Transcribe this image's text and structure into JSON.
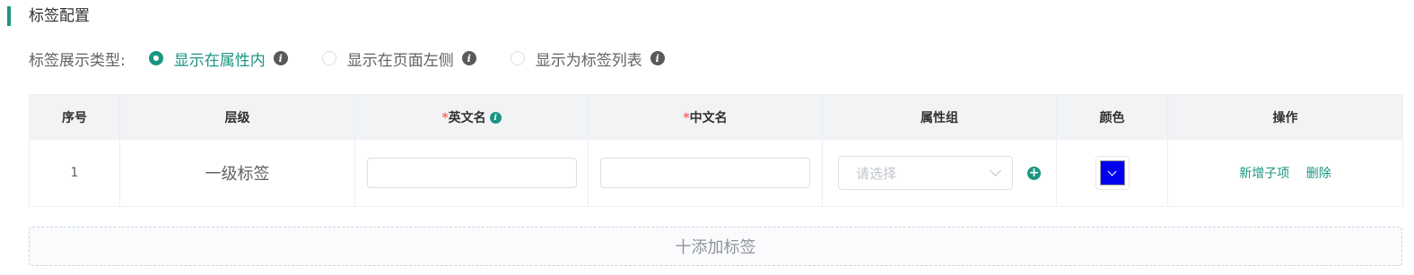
{
  "section": {
    "title": "标签配置"
  },
  "display_type": {
    "label": "标签展示类型:",
    "options": [
      {
        "label": "显示在属性内",
        "checked": true
      },
      {
        "label": "显示在页面左侧",
        "checked": false
      },
      {
        "label": "显示为标签列表",
        "checked": false
      }
    ]
  },
  "table": {
    "headers": {
      "index": "序号",
      "level": "层级",
      "en_required": "*",
      "en_name": "英文名",
      "cn_required": "*",
      "cn_name": "中文名",
      "attr_group": "属性组",
      "color": "颜色",
      "actions": "操作"
    },
    "rows": [
      {
        "index": "1",
        "level": "一级标签",
        "en_name_value": "",
        "cn_name_value": "",
        "attr_group_placeholder": "请选择",
        "color_value": "#0000ee",
        "add_child": "新增子项",
        "delete": "删除"
      }
    ]
  },
  "add_button": {
    "label": "十添加标签"
  },
  "colors": {
    "accent": "#1a9582",
    "required": "#f56c6c"
  }
}
